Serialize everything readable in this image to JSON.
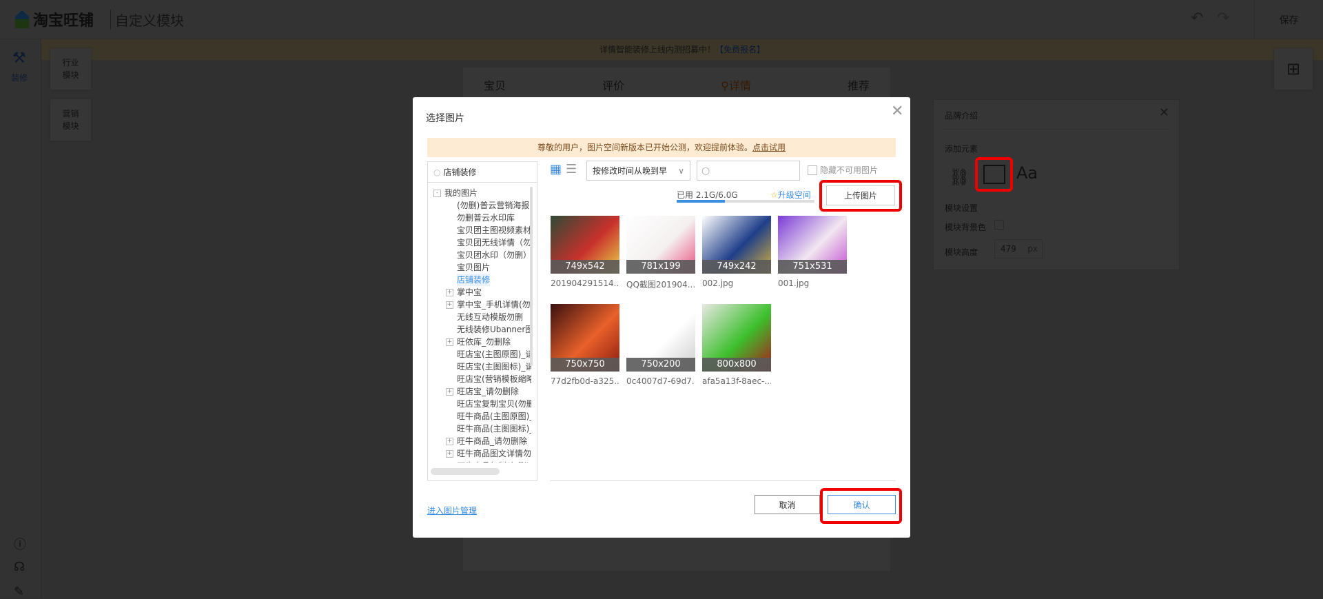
{
  "app": {
    "logo": "淘宝旺铺",
    "subtitle": "自定义模块",
    "save": "保存"
  },
  "nav": {
    "decorate": "装修"
  },
  "banner": {
    "text": "详情智能装修上线内测招募中！",
    "link": "【免费报名】"
  },
  "modules": [
    {
      "label_a": "行业",
      "label_b": "模块"
    },
    {
      "label_a": "营销",
      "label_b": "模块"
    }
  ],
  "canvas_tabs": [
    "宝贝",
    "评价",
    "详情",
    "推荐"
  ],
  "right_panel": {
    "title": "品牌介绍",
    "add_elements": "添加元素",
    "text_icon": "Aa",
    "module_settings": "模块设置",
    "bg_color": "模块背景色",
    "height_label": "模块高度",
    "height_value": "479",
    "height_unit": "px"
  },
  "dialog": {
    "title": "选择图片",
    "notice": "尊敬的用户，图片空间新版本已开始公测，欢迎提前体验。",
    "notice_link": "点击试用",
    "tree_search": "店铺装修",
    "tree": [
      {
        "label": "我的图片",
        "level": 0,
        "toggle": "-"
      },
      {
        "label": "(勿删)普云营销海报",
        "level": 2
      },
      {
        "label": "勿删普云水印库",
        "level": 2
      },
      {
        "label": "宝贝团主图视频素材",
        "level": 2
      },
      {
        "label": "宝贝团无线详情（勿",
        "level": 2
      },
      {
        "label": "宝贝团水印（勿删）",
        "level": 2
      },
      {
        "label": "宝贝图片",
        "level": 2
      },
      {
        "label": "店铺装修",
        "level": 2,
        "selected": true
      },
      {
        "label": "掌中宝",
        "level": 1,
        "toggle": "+"
      },
      {
        "label": "掌中宝_手机详情(勿",
        "level": 1,
        "toggle": "+"
      },
      {
        "label": "无线互动模版勿删",
        "level": 2
      },
      {
        "label": "无线装修Ubanner图",
        "level": 2
      },
      {
        "label": "旺依库_勿删除",
        "level": 1,
        "toggle": "+"
      },
      {
        "label": "旺店宝(主图原图)_请",
        "level": 2
      },
      {
        "label": "旺店宝(主图图标)_请",
        "level": 2
      },
      {
        "label": "旺店宝(营销模板缩略",
        "level": 2
      },
      {
        "label": "旺店宝_请勿删除",
        "level": 1,
        "toggle": "+"
      },
      {
        "label": "旺店宝复制宝贝(勿删",
        "level": 2
      },
      {
        "label": "旺牛商品(主图原图)_",
        "level": 2
      },
      {
        "label": "旺牛商品(主图图标)_",
        "level": 2
      },
      {
        "label": "旺牛商品_请勿删除",
        "level": 1,
        "toggle": "+"
      },
      {
        "label": "旺牛商品图文详情勿",
        "level": 1,
        "toggle": "+"
      },
      {
        "label": "旺牛商品复制(勿删)",
        "level": 2
      }
    ],
    "sort": "按修改时间从晚到早",
    "search_placeholder": "",
    "hide_unavailable": "隐藏不可用图片",
    "usage": "已用 2.1G/6.0G",
    "usage_fraction": 0.35,
    "upgrade": "升级空间",
    "upload": "上传图片",
    "images": [
      {
        "dim": "749x542",
        "name": "201904291514...",
        "colors": [
          "#2e4a35",
          "#c9302c",
          "#e8d44a"
        ]
      },
      {
        "dim": "781x199",
        "name": "QQ截图201904...",
        "colors": [
          "#ffffff",
          "#f4f0f0",
          "#e84f7d"
        ]
      },
      {
        "dim": "749x242",
        "name": "002.jpg",
        "colors": [
          "#ffffff",
          "#1f3f8a",
          "#d9b23a"
        ]
      },
      {
        "dim": "751x531",
        "name": "001.jpg",
        "colors": [
          "#7a3bd6",
          "#f2e6f0",
          "#c04bd0"
        ]
      },
      {
        "dim": "750x750",
        "name": "77d2fb0d-a325...",
        "colors": [
          "#3a1010",
          "#e8602a",
          "#8a1a10"
        ]
      },
      {
        "dim": "750x200",
        "name": "0c4007d7-69d7...",
        "colors": [
          "#ffffff",
          "#ffffff",
          "#cccccc"
        ]
      },
      {
        "dim": "800x800",
        "name": "afa5a13f-8aec-...",
        "colors": [
          "#e8e8e4",
          "#3dbf2c",
          "#b0151b"
        ]
      }
    ],
    "manage_link": "进入图片管理",
    "cancel": "取消",
    "confirm": "确认"
  },
  "colors": {
    "accent": "#3b8de0",
    "highlight": "#e00000",
    "notice_bg": "#fdebd3"
  }
}
